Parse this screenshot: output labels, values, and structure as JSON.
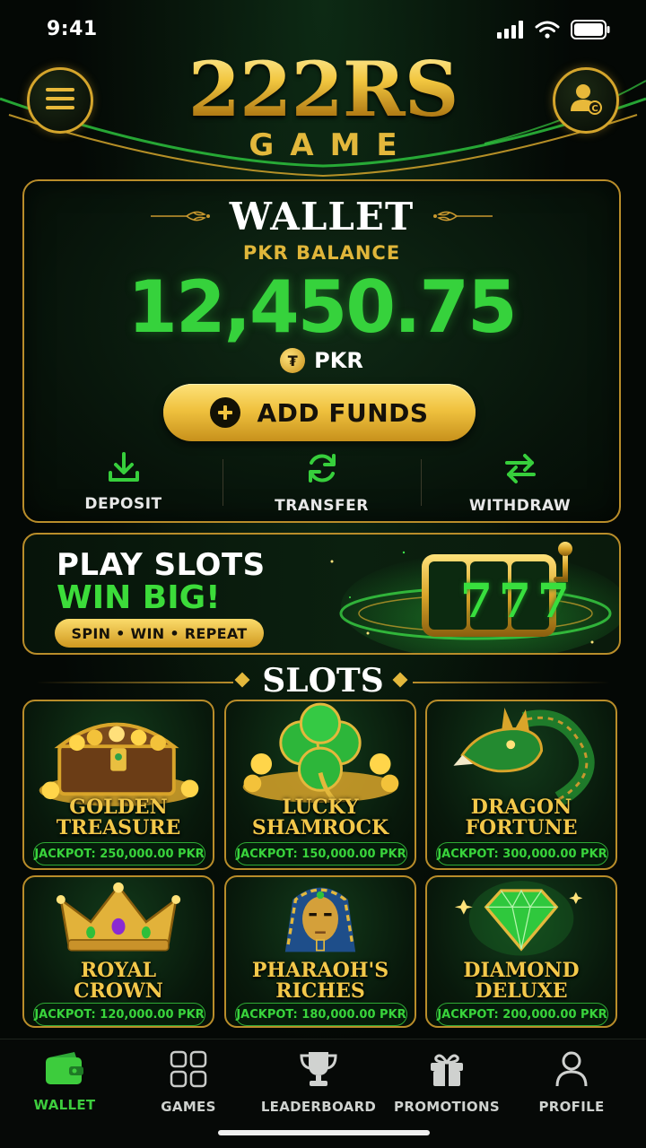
{
  "status_bar": {
    "time": "9:41",
    "icons": [
      "signal-icon",
      "wifi-icon",
      "battery-icon"
    ]
  },
  "header": {
    "logo_title": "222RS",
    "logo_subtitle": "GAME",
    "menu_icon": "hamburger-menu-icon",
    "profile_icon": "user-profile-icon"
  },
  "wallet": {
    "title": "WALLET",
    "subtitle": "PKR BALANCE",
    "amount": "12,450.75",
    "currency": "PKR",
    "add_funds_label": "ADD FUNDS",
    "actions": [
      {
        "label": "DEPOSIT",
        "icon": "download-icon"
      },
      {
        "label": "TRANSFER",
        "icon": "refresh-icon"
      },
      {
        "label": "WITHDRAW",
        "icon": "swap-arrows-icon"
      }
    ]
  },
  "promo": {
    "line1": "PLAY SLOTS",
    "line2": "WIN BIG!",
    "tagline": "SPIN • WIN • REPEAT",
    "reel_symbols": [
      "7",
      "7",
      "7"
    ]
  },
  "slots": {
    "title": "SLOTS",
    "games": [
      {
        "name_line1": "GOLDEN",
        "name_line2": "TREASURE",
        "jackpot": "JACKPOT: 250,000.00 PKR",
        "art": "treasure-chest-icon"
      },
      {
        "name_line1": "LUCKY",
        "name_line2": "SHAMROCK",
        "jackpot": "JACKPOT: 150,000.00 PKR",
        "art": "shamrock-icon"
      },
      {
        "name_line1": "DRAGON",
        "name_line2": "FORTUNE",
        "jackpot": "JACKPOT: 300,000.00 PKR",
        "art": "dragon-icon"
      },
      {
        "name_line1": "ROYAL",
        "name_line2": "CROWN",
        "jackpot": "JACKPOT: 120,000.00 PKR",
        "art": "crown-icon"
      },
      {
        "name_line1": "PHARAOH'S",
        "name_line2": "RICHES",
        "jackpot": "JACKPOT: 180,000.00 PKR",
        "art": "pharaoh-icon"
      },
      {
        "name_line1": "DIAMOND",
        "name_line2": "DELUXE",
        "jackpot": "JACKPOT: 200,000.00 PKR",
        "art": "diamond-icon"
      }
    ]
  },
  "bottom_nav": {
    "items": [
      {
        "label": "WALLET",
        "icon": "wallet-icon",
        "active": true
      },
      {
        "label": "GAMES",
        "icon": "grid-icon",
        "active": false
      },
      {
        "label": "LEADERBOARD",
        "icon": "trophy-icon",
        "active": false
      },
      {
        "label": "PROMOTIONS",
        "icon": "gift-icon",
        "active": false
      },
      {
        "label": "PROFILE",
        "icon": "person-icon",
        "active": false
      }
    ]
  },
  "colors": {
    "gold": "#d4a52c",
    "green_accent": "#36d23c",
    "background": "#040805"
  }
}
